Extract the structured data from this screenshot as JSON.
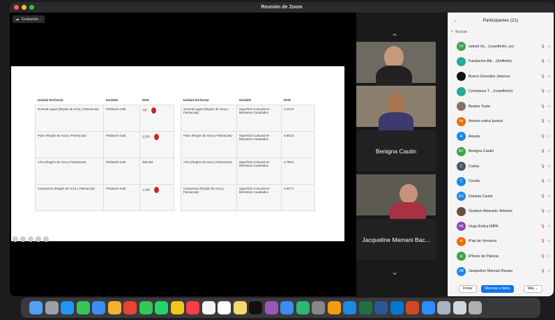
{
  "window": {
    "title": "Reunión de Zoom"
  },
  "stage": {
    "recording_label": "Grabando...",
    "slide": {
      "left_table": {
        "headers": [
          "Unidad territorial",
          "Variable",
          "2025"
        ],
        "rows": [
          {
            "unit": "General Lagos (Región de Arica y Parinacota)",
            "variable": "Población total",
            "value": "797",
            "marker": true
          },
          {
            "unit": "Putre (Región de Arica y Parinacota)",
            "variable": "Población total",
            "value": "2.578",
            "marker": true
          },
          {
            "unit": "Arica (Región de Arica y Parinacota)",
            "variable": "Población total",
            "value": "259.064",
            "marker": false
          },
          {
            "unit": "Camarones (Región de Arica y Parinacota)",
            "variable": "Población total",
            "value": "1.248",
            "marker": true
          }
        ]
      },
      "right_table": {
        "headers": [
          "Unidad territorial",
          "Variable",
          "2018"
        ],
        "rows": [
          {
            "unit": "General Lagos (Región de Arica y Parinacota)",
            "variable": "Superficie Comunal en kilómetros Cuadrados",
            "value": "2.244,0"
          },
          {
            "unit": "Putre (Región de Arica y Parinacota)",
            "variable": "Superficie Comunal en kilómetros Cuadrados",
            "value": "5.903,0"
          },
          {
            "unit": "Arica (Región de Arica y Parinacota)",
            "variable": "Superficie Comunal en kilómetros Cuadrados",
            "value": "4.799,0"
          },
          {
            "unit": "Camarones (Región de Arica y Parinacota)",
            "variable": "Superficie Comunal en kilómetros Cuadrados",
            "value": "3.927,0"
          }
        ]
      }
    }
  },
  "gallery": {
    "tiles": [
      {
        "label": "",
        "kind": "video-man"
      },
      {
        "label": "",
        "kind": "video-woman"
      },
      {
        "label": "Benigna Cautin",
        "kind": "name"
      },
      {
        "label": "",
        "kind": "video-elder"
      },
      {
        "label": "Jacqueline Mamani Bac...",
        "kind": "name"
      }
    ]
  },
  "participants": {
    "title": "Participantes (21)",
    "search_placeholder": "Buscar",
    "list": [
      {
        "initials": "VV",
        "color": "#43a047",
        "name": "valesti Va... (coanfitrión, yo)"
      },
      {
        "initials": "→",
        "color": "#26a69a",
        "name": "Fundación Alti... (Anfitrión)"
      },
      {
        "initials": "",
        "color": "#111111",
        "name": "Bosco Gonzalez Jimenez"
      },
      {
        "initials": "→",
        "color": "#26a69a",
        "name": "Constanza T... (coanfitrión)"
      },
      {
        "initials": "",
        "color": "#8d6e63",
        "name": "Beatriz Yuste"
      },
      {
        "initials": "Ae",
        "color": "#ef6c00",
        "name": "Andres estica bustos"
      },
      {
        "initials": "A",
        "color": "#1e88e5",
        "name": "Anyela"
      },
      {
        "initials": "BC",
        "color": "#43a047",
        "name": "Benigna Cautin"
      },
      {
        "initials": "C",
        "color": "#455a64",
        "name": "Carlos"
      },
      {
        "initials": "C",
        "color": "#1e88e5",
        "name": "Cecilia"
      },
      {
        "initials": "DC",
        "color": "#1e88e5",
        "name": "Daniela Cautin"
      },
      {
        "initials": "",
        "color": "#6d4c41",
        "name": "Gustavo Alvarado Jiménez"
      },
      {
        "initials": "HE",
        "color": "#8e44ad",
        "name": "Hugo Estica IMPA"
      },
      {
        "initials": "id",
        "color": "#ef6c00",
        "name": "iPad de Veronica"
      },
      {
        "initials": "id",
        "color": "#43a047",
        "name": "iPhone de Patricia"
      },
      {
        "initials": "JM",
        "color": "#1e88e5",
        "name": "Jacqueline Mamani Bacian"
      }
    ],
    "footer": {
      "invite": "Invitar",
      "mute_all": "Silenciar a todos",
      "more": "Más"
    }
  },
  "dock": {
    "apps": [
      "finder-icon",
      "launchpad-icon",
      "safari-icon",
      "messages-icon",
      "mail-icon",
      "photos-icon",
      "chrome-icon",
      "facetime-icon",
      "whatsapp-icon",
      "notes-icon",
      "music-icon",
      "reminders-icon",
      "calendar-icon",
      "notes2-icon",
      "tv-icon",
      "podcasts-icon",
      "keynote-icon",
      "numbers-icon",
      "settings-icon",
      "pages-icon",
      "appstore-icon",
      "excel-icon",
      "word-icon",
      "outlook-icon",
      "powerpoint-icon",
      "zoom-icon",
      "preview-icon",
      "screenshots-icon",
      "trash-icon"
    ],
    "colors": [
      "#4fa3f7",
      "#9aa0a6",
      "#2196f3",
      "#34c759",
      "#3a8ef6",
      "#f2b233",
      "#e84335",
      "#34c759",
      "#25d366",
      "#f5c518",
      "#fa3c4c",
      "#f5f5f5",
      "#ffffff",
      "#f5d76e",
      "#111111",
      "#9b59b6",
      "#3a8ef6",
      "#2eb872",
      "#888888",
      "#f39c12",
      "#1e88e5",
      "#1f7244",
      "#2b579a",
      "#0078d4",
      "#d24726",
      "#2d8cff",
      "#aab4c0",
      "#cfd8dc",
      "#b0b0b0"
    ]
  }
}
